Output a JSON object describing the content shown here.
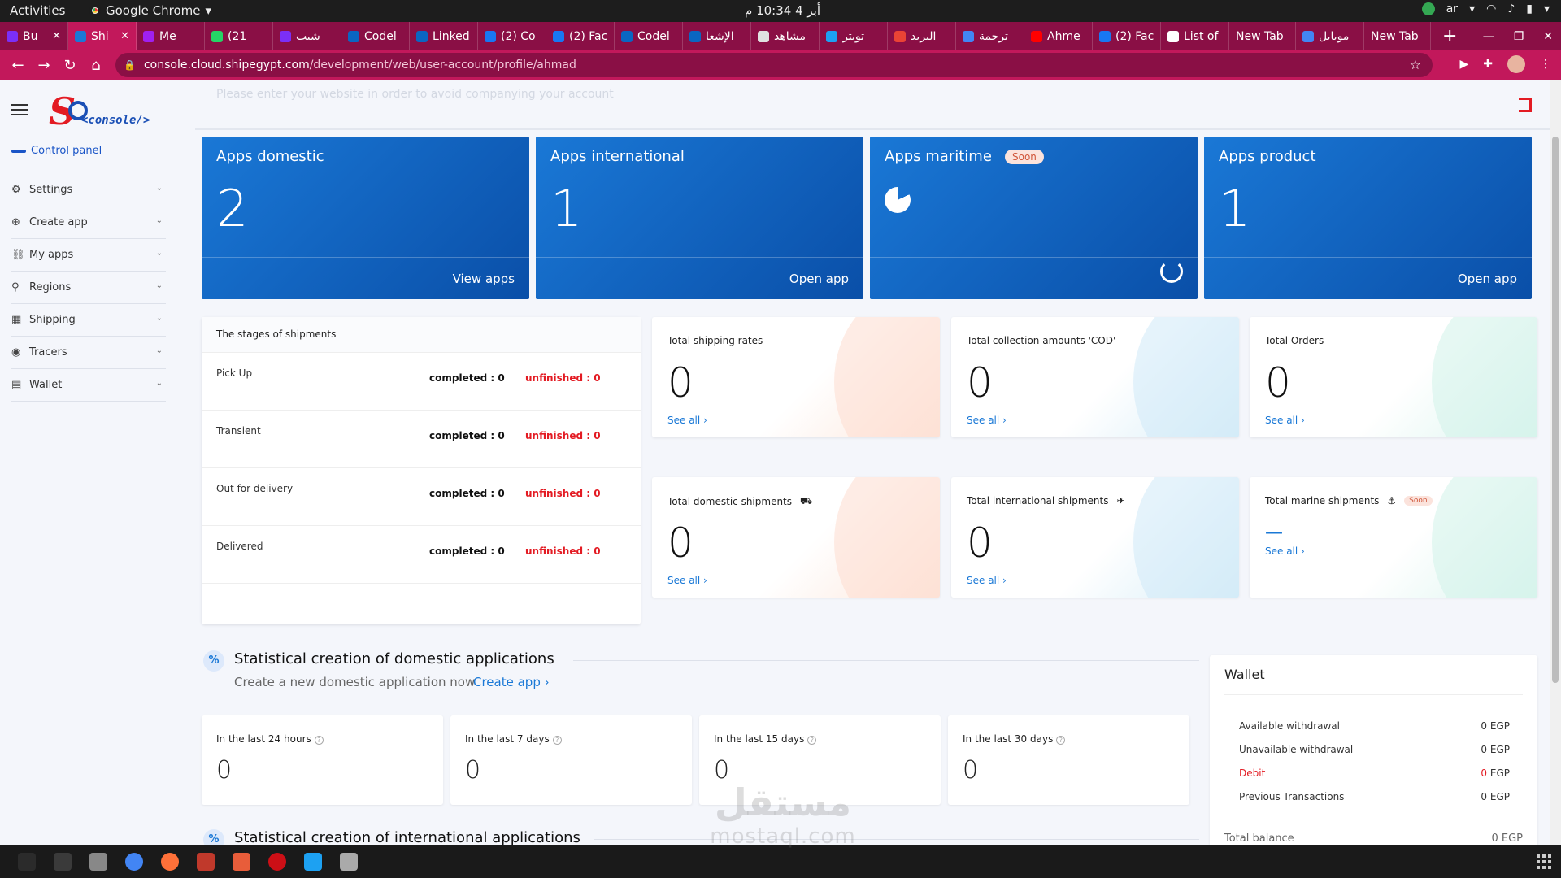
{
  "os": {
    "activities": "Activities",
    "app_name": "Google Chrome",
    "clock": "أبر 4  10:34 م",
    "lang": "ar"
  },
  "browser": {
    "tabs": [
      {
        "label": "Bu",
        "color": "#7b2ff7",
        "active": false
      },
      {
        "label": "Shi",
        "color": "#1a78d6",
        "active": true
      },
      {
        "label": "Me",
        "color": "#a020f0",
        "active": false
      },
      {
        "label": "(21",
        "color": "#25d366",
        "active": false
      },
      {
        "label": "شيب",
        "color": "#7b2ff7",
        "active": false
      },
      {
        "label": "Codel",
        "color": "#0a66c2",
        "active": false
      },
      {
        "label": "Linked",
        "color": "#0a66c2",
        "active": false
      },
      {
        "label": "(2) Co",
        "color": "#1877f2",
        "active": false
      },
      {
        "label": "(2) Fac",
        "color": "#1877f2",
        "active": false
      },
      {
        "label": "Codel",
        "color": "#0a66c2",
        "active": false
      },
      {
        "label": "الإشعا",
        "color": "#0a66c2",
        "active": false
      },
      {
        "label": "مشاهد",
        "color": "#e0e0e0",
        "active": false
      },
      {
        "label": "تويتر",
        "color": "#1da1f2",
        "active": false
      },
      {
        "label": "البريد",
        "color": "#ea4335",
        "active": false
      },
      {
        "label": "ترجمة",
        "color": "#4285f4",
        "active": false
      },
      {
        "label": "Ahme",
        "color": "#ff0000",
        "active": false
      },
      {
        "label": "(2) Fac",
        "color": "#1877f2",
        "active": false
      },
      {
        "label": "List of",
        "color": "#ffffff",
        "active": false
      },
      {
        "label": "New Tab",
        "color": "",
        "active": false
      },
      {
        "label": "موبايل",
        "color": "#4285f4",
        "active": false
      },
      {
        "label": "New Tab",
        "color": "",
        "active": false
      }
    ],
    "url_host": "console.cloud.shipegypt.com",
    "url_path": "/development/web/user-account/profile/ahmad"
  },
  "sidebar": {
    "logo_letter": "S",
    "logo_word": "<console/>",
    "control_panel": "Control panel",
    "items": [
      {
        "label": "Settings",
        "icon": "⚙"
      },
      {
        "label": "Create app",
        "icon": "⊕"
      },
      {
        "label": "My apps",
        "icon": "⛓"
      },
      {
        "label": "Regions",
        "icon": "⚲"
      },
      {
        "label": "Shipping",
        "icon": "▦"
      },
      {
        "label": "Tracers",
        "icon": "◉"
      },
      {
        "label": "Wallet",
        "icon": "▤"
      }
    ]
  },
  "header": {
    "faded_text": "Please enter your website in order to avoid companying your account"
  },
  "apps": [
    {
      "title": "Apps domestic",
      "count": "2",
      "link": "View apps"
    },
    {
      "title": "Apps international",
      "count": "1",
      "link": "Open app"
    },
    {
      "title": "Apps maritime",
      "badge": "Soon"
    },
    {
      "title": "Apps product",
      "count": "1",
      "link": "Open app"
    }
  ],
  "stages": {
    "title": "The stages of shipments",
    "rows": [
      {
        "name": "Pick Up",
        "completed": "completed : 0",
        "unfinished": "unfinished : 0"
      },
      {
        "name": "Transient",
        "completed": "completed : 0",
        "unfinished": "unfinished : 0"
      },
      {
        "name": "Out for delivery",
        "completed": "completed : 0",
        "unfinished": "unfinished : 0"
      },
      {
        "name": "Delivered",
        "completed": "completed : 0",
        "unfinished": "unfinished : 0"
      }
    ]
  },
  "stats": {
    "shipping_rates": {
      "title": "Total shipping rates",
      "value": "0",
      "link": "See all ›"
    },
    "cod": {
      "title": "Total collection amounts 'COD'",
      "value": "0",
      "link": "See all ›"
    },
    "orders": {
      "title": "Total Orders",
      "value": "0",
      "link": "See all ›"
    },
    "domestic": {
      "title": "Total domestic shipments",
      "value": "0",
      "link": "See all ›",
      "icon": "truck-icon"
    },
    "international": {
      "title": "Total international shipments",
      "value": "0",
      "link": "See all ›",
      "icon": "plane-icon"
    },
    "marine": {
      "title": "Total marine shipments",
      "value": "—",
      "link": "See all ›",
      "icon": "anchor-icon",
      "badge": "Soon"
    }
  },
  "domestic_section": {
    "title": "Statistical creation of domestic applications",
    "subtitle": "Create a new domestic application now",
    "create_link": "Create app ›",
    "periods": [
      {
        "label": "In the last 24 hours",
        "value": "0"
      },
      {
        "label": "In the last 7 days",
        "value": "0"
      },
      {
        "label": "In the last 15 days",
        "value": "0"
      },
      {
        "label": "In the last 30 days",
        "value": "0"
      }
    ]
  },
  "international_section": {
    "title": "Statistical creation of international applications"
  },
  "wallet": {
    "title": "Wallet",
    "rows": [
      {
        "name": "Available withdrawal",
        "value": "0",
        "currency": "EGP"
      },
      {
        "name": "Unavailable withdrawal",
        "value": "0",
        "currency": "EGP"
      },
      {
        "name": "Debit",
        "value": "0",
        "currency": "EGP"
      },
      {
        "name": "Previous Transactions",
        "value": "0",
        "currency": "EGP"
      }
    ],
    "total_label": "Total balance",
    "total_value": "0 EGP"
  },
  "watermark": {
    "line1": "مستقل",
    "line2": "mostaql.com"
  },
  "dock_colors": [
    "#2b2b2b",
    "#3a3a3a",
    "#888888",
    "#4285f4",
    "#ff7139",
    "#c0392b",
    "#e85d3a",
    "#cc0f16",
    "#1da1f2",
    "#aaaaaa"
  ]
}
